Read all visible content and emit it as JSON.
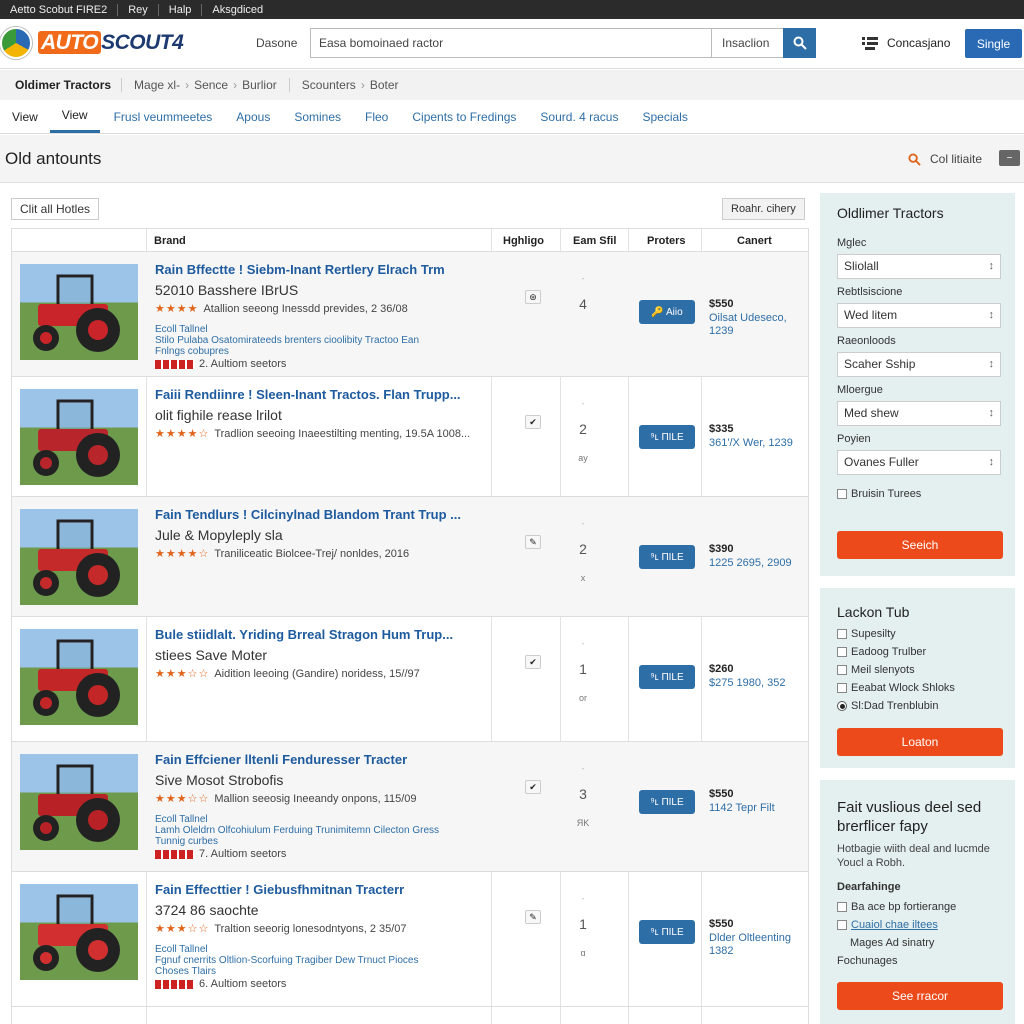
{
  "topbar": {
    "items": [
      "Aetto Scobut FIRE2",
      "Rey",
      "Halp",
      "Aksgdiced"
    ]
  },
  "header": {
    "logo_auto": "AUTO",
    "logo_scout": "SCOUT4",
    "label": "Dasone",
    "search_value": "Easa bomoinaed ractor",
    "search_select": "Insaclion",
    "user_label": "Concasjano",
    "signin_label": "Single"
  },
  "breadcrumb": {
    "c1": "Oldimer Tractors",
    "c2a": "Mage xl-",
    "c2b": "Sence",
    "c2c": "Burlior",
    "c3a": "Scounters",
    "c3b": "Boter"
  },
  "tabs": [
    "View",
    "View",
    "Frusl veummeetes",
    "Apous",
    "Somines",
    "Fleo",
    "Cipents to Fredings",
    "Sourd. 4 racus",
    "Specials"
  ],
  "page": {
    "title": "Old antounts",
    "collect_label": "Col litiaite",
    "collect_btn": "−",
    "clear_label": "Clit all Hotles",
    "sort_label": "Roahr. cihery"
  },
  "table": {
    "headers": {
      "brand": "Brand",
      "highlight": "Hghligo",
      "state": "Eam Sfil",
      "protect": "Proters",
      "cart": "Canert"
    }
  },
  "listings": [
    {
      "title": "Rain Bffectte ! Siebm-Inant Rertlery Elrach Trm",
      "sub": "52010 Basshere IBrUS",
      "stars": "★★★★",
      "meta": "Atallion seeong Inessdd prevides, 2 36/08",
      "desc1": "Ecoll Tallnel",
      "desc2": "Stilo Pulaba  Osatomirateeds brenters cioolibity Tractoo Ean",
      "desc3": "Fnlngs cobupres",
      "seller": "2. Aultiom seetors",
      "hl": "⊛",
      "s1": "-",
      "n": "4",
      "s2": "",
      "btn": "🔑 Aiio",
      "price": "$550",
      "loc": "Oilsat Udeseco, 1239"
    },
    {
      "title": "Faiii Rendiinre ! Sleen-Inant Tractos. Flan Trupp...",
      "sub": "olit fighile rease lrilot",
      "stars": "★★★★☆",
      "meta": "Tradlion seeoing Inaeestilting menting, 19.5A 1008...",
      "desc1": "",
      "desc2": "",
      "desc3": "",
      "seller": "",
      "hl": "✔",
      "s1": "-",
      "n": "2",
      "s2": "ay",
      "btn": "⁹ʟ ПILE",
      "price": "$335",
      "loc": "361'/X Wer, 1239"
    },
    {
      "title": "Fain Tendlurs ! Cilcinylnad Blandom Trant Trup ...",
      "sub": "Jule & Mopyleply sla",
      "stars": "★★★★☆",
      "meta": "Traniliceatic Biolcee-Trej/ nonldes, 2016",
      "desc1": "",
      "desc2": "",
      "desc3": "",
      "seller": "",
      "hl": "✎",
      "s1": "-",
      "n": "2",
      "s2": "x",
      "btn": "⁹ʟ ПILE",
      "price": "$390",
      "loc": "1225 2695, 2909"
    },
    {
      "title": "Bule stiidlalt. Yriding Brreal Stragon Hum Trup...",
      "sub": "stiees Save Moter",
      "stars": "★★★☆☆",
      "meta": "Aidition leeoing (Gandire) noridess, 15//97",
      "desc1": "",
      "desc2": "",
      "desc3": "",
      "seller": "",
      "hl": "✔",
      "s1": "-",
      "n": "1",
      "s2": "or",
      "btn": "⁹ʟ ПILE",
      "price": "$260",
      "loc": "$275 1980, 352"
    },
    {
      "title": "Fain Effciener lltenli Fenduresser Tracter",
      "sub": "Sive Mosot Strobofis",
      "stars": "★★★☆☆",
      "meta": "Mallion seeosig Ineeandy onpons, 115/09",
      "desc1": "Ecoll Tallnel",
      "desc2": "Lamh Oleldrn  Olfcohiulum Ferduing Trunimitemn Cilecton Gress",
      "desc3": "Tunnig curbes",
      "seller": "7. Aultiom seetors",
      "hl": "✔",
      "s1": "-",
      "n": "3",
      "s2": "ЯK",
      "btn": "⁹ʟ ПILE",
      "price": "$550",
      "loc": "1142 Tepr Filt"
    },
    {
      "title": "Fain Effecttier ! Giebusfhmitnan Tracterr",
      "sub": "3724 86 saochte",
      "stars": "★★★☆☆",
      "meta": "Traltion seeorig lonesodntyons, 2 35/07",
      "desc1": "Ecoll Tallnel",
      "desc2": "Fgnuf cnerrits  Oltlion-Scorfuing Tragiber Dew Trnuct Pioces",
      "desc3": "Choses Tlairs",
      "seller": "6. Aultiom seetors",
      "hl": "✎",
      "s1": "-",
      "n": "1",
      "s2": "ɑ",
      "btn": "⁹ʟ ПILE",
      "price": "$550",
      "loc": "Dlder Oltleenting 1382"
    }
  ],
  "sidebar": {
    "panel1": {
      "title": "Oldlimer Tractors",
      "f1_label": "Mglec",
      "f1_value": "Sliolall",
      "f2_label": "Rebtlsiscione",
      "f2_value": "Wed litem",
      "f3_label": "Raeonloods",
      "f3_value": "Scaher Sship",
      "f4_label": "Mloergue",
      "f4_value": "Med shew",
      "f5_label": "Poyien",
      "f5_value": "Ovanes Fuller",
      "checkbox": "Bruisin Turees",
      "button": "Seeich"
    },
    "panel2": {
      "title": "Lackon Tub",
      "items": [
        "Supesilty",
        "Eadoog Trulber",
        "Meil slenyots",
        "Eeabat Wlock Shloks",
        "Sl:Dad Trenblubin"
      ],
      "button": "Loaton"
    },
    "panel3": {
      "title": "Fait vuslious deel sed brerflicer fapy",
      "text": "Hotbagie wiith deal and lucmde Youcl a Robh.",
      "subhead": "Dearfahinge",
      "opt1": "Ba ace bp fortierange",
      "opt2": "Cuaiol chae iltees",
      "opt3": "Mages Ad sinatry",
      "opt4": "Fochunages",
      "button": "See rracor"
    }
  },
  "colors": {
    "accent": "#2e6ea6",
    "orange": "#ec4a1a",
    "sidebar": "#e4efef"
  }
}
